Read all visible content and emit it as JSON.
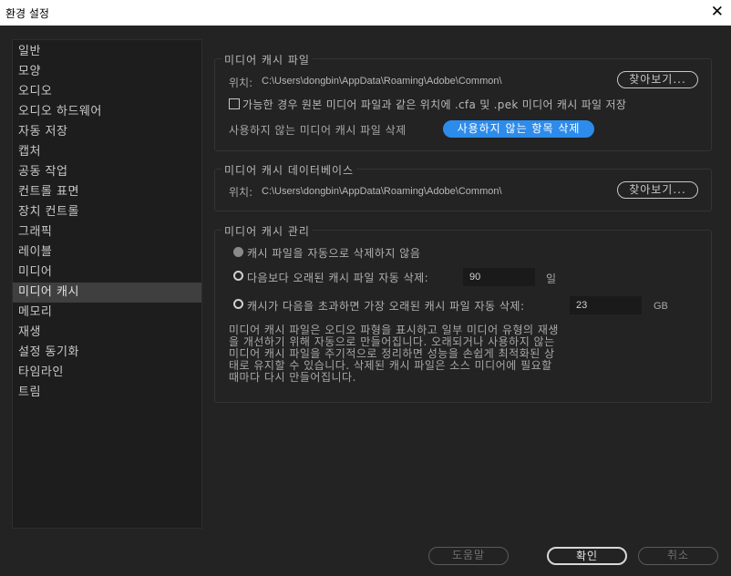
{
  "window": {
    "title": "환경 설정",
    "close_glyph": "✕"
  },
  "sidebar": {
    "items": [
      {
        "label": "일반"
      },
      {
        "label": "모양"
      },
      {
        "label": "오디오"
      },
      {
        "label": "오디오 하드웨어"
      },
      {
        "label": "자동 저장"
      },
      {
        "label": "캡처"
      },
      {
        "label": "공동 작업"
      },
      {
        "label": "컨트롤 표면"
      },
      {
        "label": "장치 컨트롤"
      },
      {
        "label": "그래픽"
      },
      {
        "label": "레이블"
      },
      {
        "label": "미디어"
      },
      {
        "label": "미디어 캐시",
        "selected": true
      },
      {
        "label": "메모리"
      },
      {
        "label": "재생"
      },
      {
        "label": "설정 동기화"
      },
      {
        "label": "타임라인"
      },
      {
        "label": "트림"
      }
    ]
  },
  "cache_files": {
    "legend": "미디어 캐시 파일",
    "location_label": "위치:",
    "location_path": "C:\\Users\\dongbin\\AppData\\Roaming\\Adobe\\Common\\",
    "browse_label": "찾아보기...",
    "checkbox_label": "가능한 경우 원본 미디어 파일과 같은 위치에 .cfa 및 .pek 미디어 캐시 파일 저장",
    "checkbox_checked": false,
    "delete_unused_label": "사용하지 않는 미디어 캐시 파일 삭제",
    "delete_unused_button": "사용하지 않는 항목 삭제"
  },
  "cache_database": {
    "legend": "미디어 캐시 데이터베이스",
    "location_label": "위치:",
    "location_path": "C:\\Users\\dongbin\\AppData\\Roaming\\Adobe\\Common\\",
    "browse_label": "찾아보기..."
  },
  "cache_management": {
    "legend": "미디어 캐시 관리",
    "option1_label": "캐시 파일을 자동으로 삭제하지 않음",
    "option2_label": "다음보다 오래된 캐시 파일 자동 삭제:",
    "option2_value": "90",
    "option2_unit": "일",
    "option3_label": "캐시가 다음을 초과하면 가장 오래된 캐시 파일 자동 삭제:",
    "option3_value": "23",
    "option3_unit": "GB",
    "selected_option": 1,
    "description_lines": [
      "미디어 캐시 파일은 오디오 파형을 표시하고 일부 미디어 유형의 재생",
      "을 개선하기 위해 자동으로 만들어집니다. 오래되거나 사용하지 않는",
      "미디어 캐시 파일을 주기적으로 정리하면 성능을 손쉽게 최적화된 상",
      "태로 유지할 수 있습니다. 삭제된 캐시 파일은 소스 미디어에 필요할",
      "때마다 다시 만들어집니다."
    ]
  },
  "footer": {
    "help_label": "도움말",
    "ok_label": "확인",
    "cancel_label": "취소"
  },
  "colors": {
    "background": "#232323",
    "panel": "#1d1d1d",
    "accent_blue": "#2d8ceb",
    "text": "#c8c8c8"
  }
}
